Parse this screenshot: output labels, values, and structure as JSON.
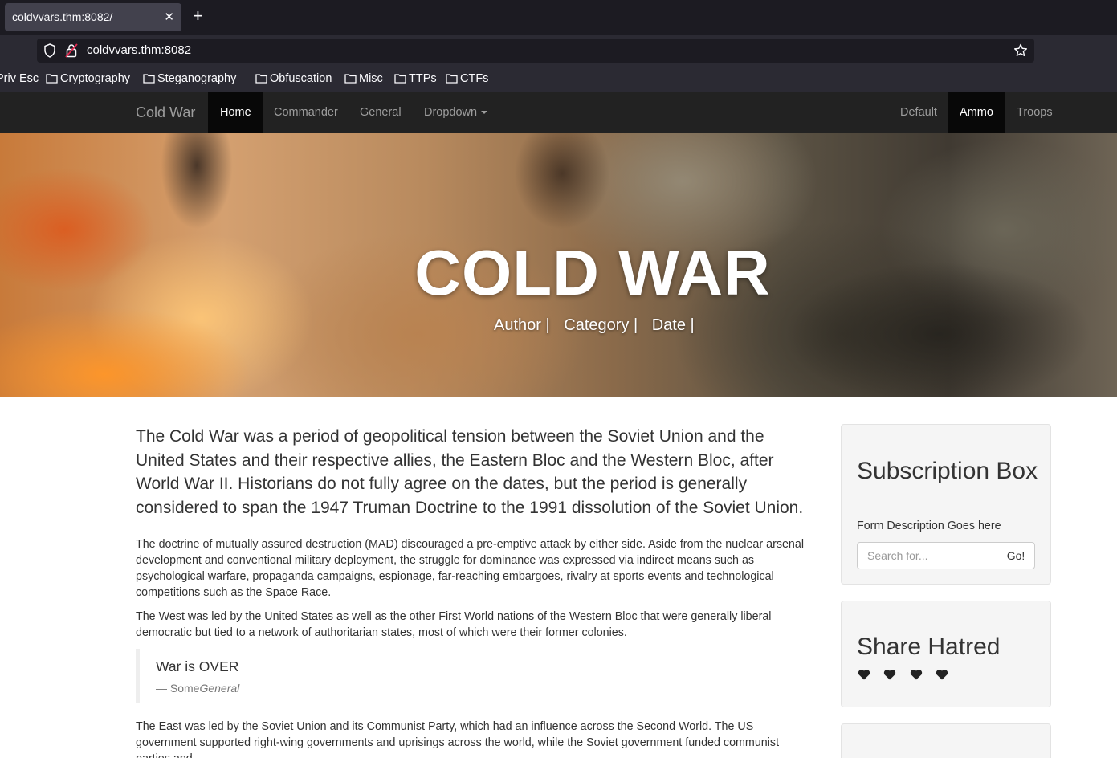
{
  "browser": {
    "tab_title": "coldvvars.thm:8082/",
    "url": "coldvvars.thm:8082",
    "bookmarks": [
      "Priv Esc",
      "Cryptography",
      "Steganography",
      "Obfuscation",
      "Misc",
      "TTPs",
      "CTFs"
    ]
  },
  "site_nav": {
    "brand": "Cold War",
    "left_items": [
      "Home",
      "Commander",
      "General",
      "Dropdown"
    ],
    "right_items": [
      "Default",
      "Ammo",
      "Troops"
    ]
  },
  "hero": {
    "title": "COLD WAR",
    "meta": [
      "Author |",
      "Category |",
      "Date |"
    ]
  },
  "article": {
    "lead": "The Cold War was a period of geopolitical tension between the Soviet Union and the United States and their respective allies, the Eastern Bloc and the Western Bloc, after World War II. Historians do not fully agree on the dates, but the period is generally considered to span the 1947 Truman Doctrine to the 1991 dissolution of the Soviet Union.",
    "para1": "The doctrine of mutually assured destruction (MAD) discouraged a pre-emptive attack by either side. Aside from the nuclear arsenal development and conventional military deployment, the struggle for dominance was expressed via indirect means such as psychological warfare, propaganda campaigns, espionage, far-reaching embargoes, rivalry at sports events and technological competitions such as the Space Race.",
    "para2": "The West was led by the United States as well as the other First World nations of the Western Bloc that were generally liberal democratic but tied to a network of authoritarian states, most of which were their former colonies.",
    "quote_text": "War is OVER",
    "quote_author": "— Some",
    "quote_source": "General",
    "para3": "The East was led by the Soviet Union and its Communist Party, which had an influence across the Second World. The US government supported right-wing governments and uprisings across the world, while the Soviet government funded communist parties and"
  },
  "sidebar": {
    "subscription_title": "Subscription Box",
    "form_description": "Form Description Goes here",
    "search_placeholder": "Search for...",
    "go_label": "Go!",
    "share_title": "Share Hatred",
    "hearts_icon": "heart-icon"
  },
  "colors": {
    "navbar_bg": "#222222",
    "navbar_active": "#080808",
    "well_bg": "#f5f5f5"
  }
}
